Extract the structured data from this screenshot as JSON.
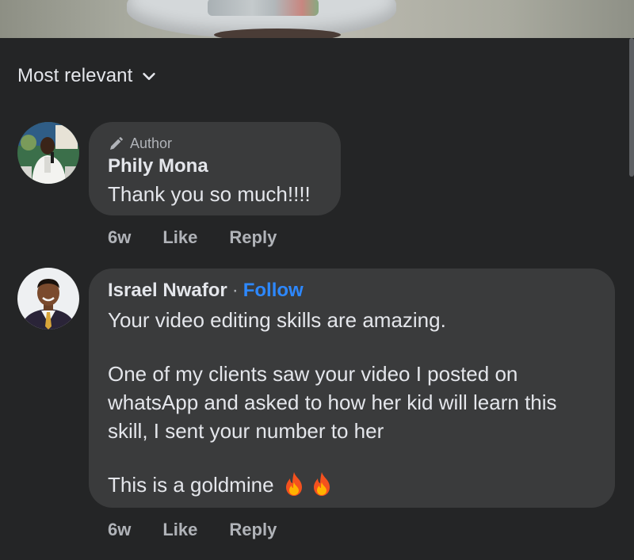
{
  "sort": {
    "label": "Most relevant",
    "icon": "chevron-down-icon"
  },
  "comments": [
    {
      "author_badge": "Author",
      "badge_icon": "pencil-icon",
      "name": "Phily Mona",
      "text": "Thank you so much!!!!",
      "time": "6w",
      "like_label": "Like",
      "reply_label": "Reply"
    },
    {
      "name": "Israel Nwafor",
      "separator": "·",
      "follow_label": "Follow",
      "line1": "Your video editing skills are amazing.",
      "line2": "One of my clients saw your video I posted on",
      "line3": "whatsApp and asked to how her kid will learn this",
      "line4": "skill, I sent your number to her",
      "line5": "This is a goldmine",
      "emoji": "fire-icon",
      "time": "6w",
      "like_label": "Like",
      "reply_label": "Reply"
    }
  ],
  "colors": {
    "background": "#242526",
    "bubble": "#3a3b3c",
    "link": "#2d88ff",
    "muted": "#b0b3b8",
    "text": "#e4e6eb"
  }
}
